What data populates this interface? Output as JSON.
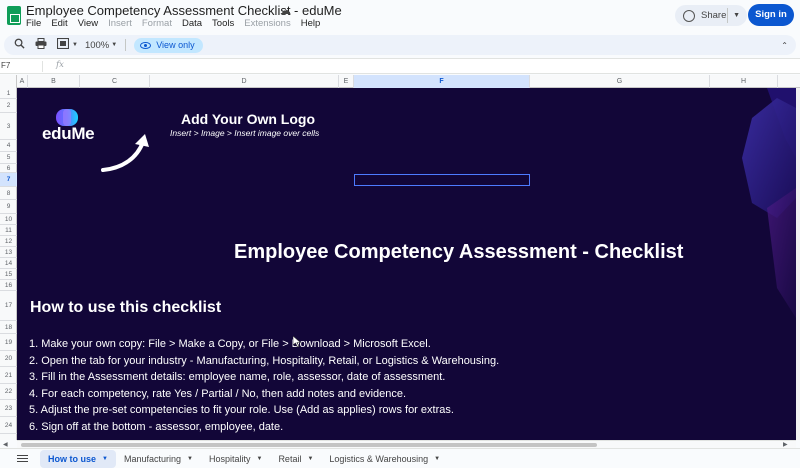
{
  "app": {
    "doc_title": "Employee Competency Assessment Checklist - eduMe",
    "menu": [
      {
        "label": "File",
        "disabled": false
      },
      {
        "label": "Edit",
        "disabled": false
      },
      {
        "label": "View",
        "disabled": false
      },
      {
        "label": "Insert",
        "disabled": true
      },
      {
        "label": "Format",
        "disabled": true
      },
      {
        "label": "Data",
        "disabled": false
      },
      {
        "label": "Tools",
        "disabled": false
      },
      {
        "label": "Extensions",
        "disabled": true
      },
      {
        "label": "Help",
        "disabled": false
      }
    ],
    "share_label": "Share",
    "signin_label": "Sign in",
    "brand_color": "#0b57d0"
  },
  "toolbar": {
    "zoom": "100%",
    "view_only_label": "View only"
  },
  "formula_bar": {
    "name_box": "F7",
    "fx_label": "fx"
  },
  "grid": {
    "columns": [
      {
        "label": "A",
        "selected": false
      },
      {
        "label": "B",
        "selected": false
      },
      {
        "label": "C",
        "selected": false
      },
      {
        "label": "D",
        "selected": false
      },
      {
        "label": "E",
        "selected": false
      },
      {
        "label": "F",
        "selected": true
      },
      {
        "label": "G",
        "selected": false
      },
      {
        "label": "H",
        "selected": false
      }
    ],
    "rows": [
      {
        "label": "1",
        "selected": false
      },
      {
        "label": "2",
        "selected": false
      },
      {
        "label": "3",
        "selected": false
      },
      {
        "label": "4",
        "selected": false
      },
      {
        "label": "5",
        "selected": false
      },
      {
        "label": "6",
        "selected": false
      },
      {
        "label": "7",
        "selected": true
      },
      {
        "label": "8",
        "selected": false
      },
      {
        "label": "9",
        "selected": false
      },
      {
        "label": "10",
        "selected": false
      },
      {
        "label": "11",
        "selected": false
      },
      {
        "label": "12",
        "selected": false
      },
      {
        "label": "13",
        "selected": false
      },
      {
        "label": "14",
        "selected": false
      },
      {
        "label": "15",
        "selected": false
      },
      {
        "label": "16",
        "selected": false
      },
      {
        "label": "17",
        "selected": false
      },
      {
        "label": "18",
        "selected": false
      },
      {
        "label": "19",
        "selected": false
      },
      {
        "label": "20",
        "selected": false
      },
      {
        "label": "21",
        "selected": false
      },
      {
        "label": "22",
        "selected": false
      },
      {
        "label": "23",
        "selected": false
      },
      {
        "label": "24",
        "selected": false
      }
    ]
  },
  "sheet": {
    "background": "#120638",
    "logo_text": "eduMe",
    "add_logo_title": "Add Your Own Logo",
    "add_logo_subtitle": "Insert > Image > Insert image over cells",
    "main_title": "Employee Competency Assessment - Checklist",
    "howto_title": "How to use this checklist",
    "steps": [
      "1. Make your own copy: File > Make a Copy, or File > Download > Microsoft Excel.",
      "2. Open the tab for your industry - Manufacturing, Hospitality, Retail, or Logistics & Warehousing.",
      "3. Fill in the Assessment details: employee name, role, assessor, date of assessment.",
      "4. For each competency, rate Yes / Partial / No, then add notes and evidence.",
      "5. Adjust the pre-set competencies to fit your role. Use (Add as applies) rows for extras.",
      "6. Sign off at the bottom - assessor, employee, date."
    ]
  },
  "tabs": [
    {
      "label": "How to use",
      "active": true
    },
    {
      "label": "Manufacturing",
      "active": false
    },
    {
      "label": "Hospitality",
      "active": false
    },
    {
      "label": "Retail",
      "active": false
    },
    {
      "label": "Logistics & Warehousing",
      "active": false
    }
  ]
}
